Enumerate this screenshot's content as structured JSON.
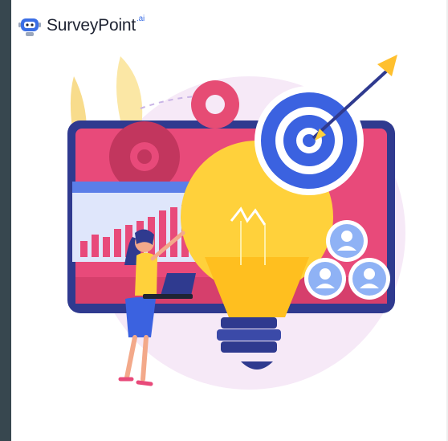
{
  "brand": {
    "name": "SurveyPoint",
    "suffix": ".ai",
    "icon": "robot-logo-icon"
  },
  "illustration": {
    "icons": [
      "gear-icon",
      "target-icon",
      "arrow-icon",
      "bar-chart-icon",
      "lightbulb-icon",
      "user-avatar-icon",
      "laptop-icon"
    ],
    "colors": {
      "monitor": "#e84a7a",
      "bulb": "#ffd13b",
      "target": "#3b62e0",
      "accent": "#2f3a8f"
    }
  }
}
